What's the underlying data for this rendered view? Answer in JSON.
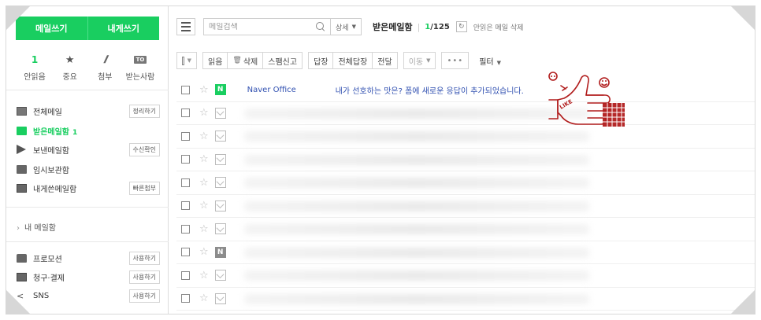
{
  "compose": {
    "write_label": "메일쓰기",
    "write_self_label": "내게쓰기"
  },
  "quick": [
    {
      "value": "1",
      "label": "안읽음"
    },
    {
      "value": "★",
      "label": "중요"
    },
    {
      "value": "𝒍",
      "label": "첨부"
    },
    {
      "value": "TO",
      "label": "받는사람"
    }
  ],
  "folders": [
    {
      "name": "전체메일",
      "tag": "정리하기"
    },
    {
      "name": "받은메일함",
      "count": "1"
    },
    {
      "name": "보낸메일함",
      "tag": "수신확인"
    },
    {
      "name": "임시보관함"
    },
    {
      "name": "내게쓴메일함",
      "tag": "빠른첨부"
    }
  ],
  "my_box": "내 메일함",
  "extras": [
    {
      "name": "프로모션",
      "tag": "사용하기"
    },
    {
      "name": "청구·결제",
      "tag": "사용하기"
    },
    {
      "name": "SNS",
      "tag": "사용하기"
    }
  ],
  "toolbar": {
    "search_placeholder": "메일검색",
    "detail_label": "상세",
    "box_title": "받은메일함",
    "unread_count": "1",
    "total_count": "/125",
    "delete_unread_label": "안읽은 메일 삭제",
    "read_label": "읽음",
    "delete_label": "삭제",
    "spam_label": "스팸신고",
    "reply_label": "답장",
    "reply_all_label": "전체답장",
    "forward_label": "전달",
    "move_label": "이동",
    "more_label": "•••",
    "filter_label": "필터"
  },
  "first_mail": {
    "sender": "Naver Office",
    "subject": "내가 선호하는 맛은? 폼에 새로운 응답이 추가되었습니다."
  },
  "sticker_text": "LIKE",
  "colors": {
    "brand_green": "#19ce60",
    "link_blue": "#2f4fb0",
    "sticker_red": "#b11d1d"
  }
}
